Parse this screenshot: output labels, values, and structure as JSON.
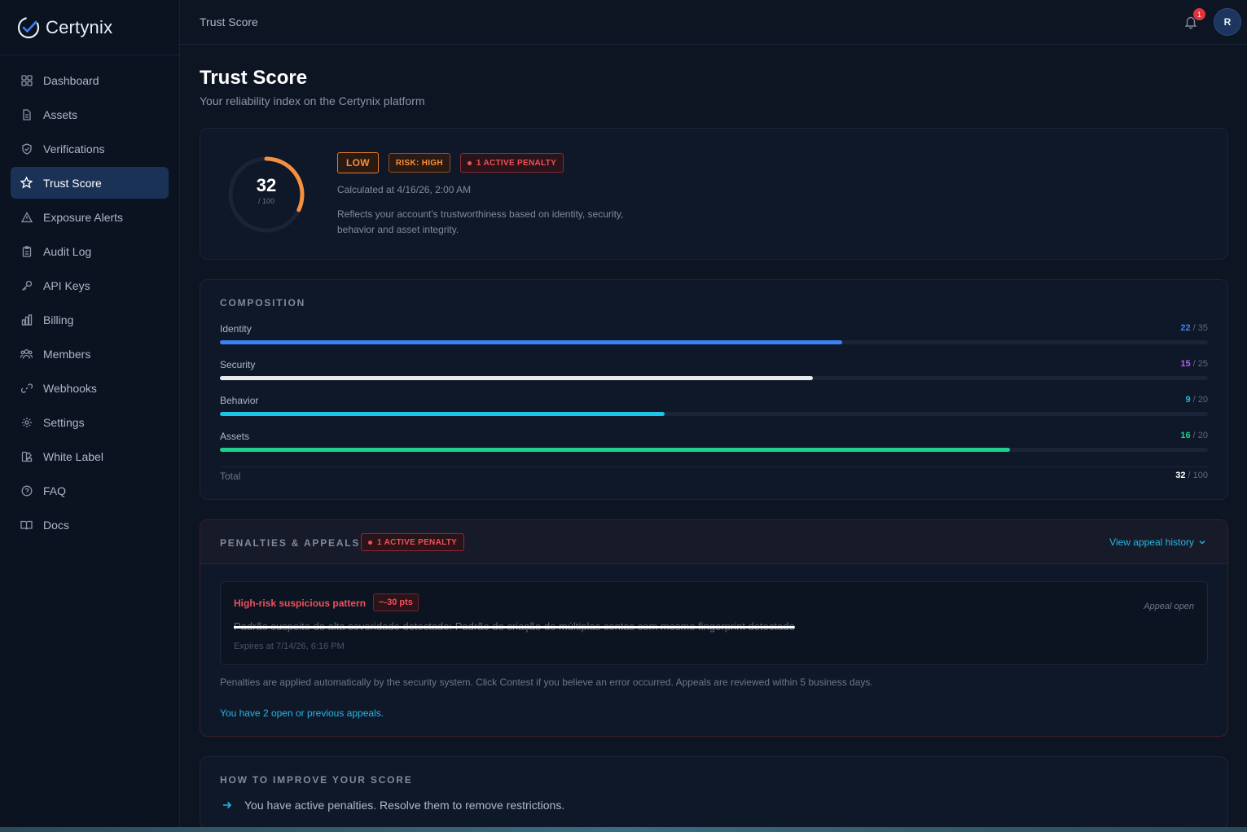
{
  "brand": {
    "name": "Certynix"
  },
  "sidebar": {
    "items": [
      {
        "label": "Dashboard",
        "icon": "dashboard-grid-icon"
      },
      {
        "label": "Assets",
        "icon": "document-icon"
      },
      {
        "label": "Verifications",
        "icon": "shield-check-icon"
      },
      {
        "label": "Trust Score",
        "icon": "star-icon",
        "active": true
      },
      {
        "label": "Exposure Alerts",
        "icon": "warning-triangle-icon"
      },
      {
        "label": "Audit Log",
        "icon": "clipboard-icon"
      },
      {
        "label": "API Keys",
        "icon": "key-icon"
      },
      {
        "label": "Billing",
        "icon": "bar-chart-icon"
      },
      {
        "label": "Members",
        "icon": "users-icon"
      },
      {
        "label": "Webhooks",
        "icon": "link-icon"
      },
      {
        "label": "Settings",
        "icon": "gear-icon"
      },
      {
        "label": "White Label",
        "icon": "palette-icon"
      },
      {
        "label": "FAQ",
        "icon": "help-circle-icon"
      },
      {
        "label": "Docs",
        "icon": "book-icon"
      }
    ]
  },
  "header": {
    "breadcrumb": "Trust Score",
    "notifications_count": "1",
    "avatar_initial": "R"
  },
  "page": {
    "title": "Trust Score",
    "subtitle": "Your reliability index on the Certynix platform"
  },
  "score": {
    "value": "32",
    "max_label": "/ 100",
    "fraction": 0.32,
    "level_badge": "LOW",
    "risk_badge": "RISK: HIGH",
    "penalty_badge": "1 ACTIVE PENALTY",
    "calculated": "Calculated at 4/16/26, 2:00 AM",
    "description": "Reflects your account's trustworthiness based on identity, security, behavior and asset integrity.",
    "gauge_color": "#f5913e"
  },
  "composition": {
    "label": "COMPOSITION",
    "rows": [
      {
        "label": "Identity",
        "value": "22",
        "max": "/ 35",
        "value_color": "#3b82f6",
        "bar_color": "#3b82f6",
        "fraction": 0.63
      },
      {
        "label": "Security",
        "value": "15",
        "max": "/ 25",
        "value_color": "#b35cf2",
        "bar_color": "#e8eaee",
        "fraction": 0.6
      },
      {
        "label": "Behavior",
        "value": "9",
        "max": "/ 20",
        "value_color": "#22b8e6",
        "bar_color": "#1cc4e6",
        "fraction": 0.45
      },
      {
        "label": "Assets",
        "value": "16",
        "max": "/ 20",
        "value_color": "#1fcf8e",
        "bar_color": "#1fcf8e",
        "fraction": 0.8
      }
    ],
    "total_label": "Total",
    "total_value": "32",
    "total_max": "/ 100"
  },
  "penalties": {
    "label": "PENALTIES & APPEALS",
    "badge": "1 ACTIVE PENALTY",
    "appeal_history_link": "View appeal history",
    "item": {
      "title": "High-risk suspicious pattern",
      "points": "−-30 pts",
      "status": "Appeal open",
      "description": "Padrão suspeito de alta severidade detectado: Padrão de criação de múltiplas contas com mesmo fingerprint detectado",
      "expires": "Expires at 7/14/26, 6:16 PM"
    },
    "note": "Penalties are applied automatically by the security system. Click Contest if you believe an error occurred. Appeals are reviewed within 5 business days.",
    "appeals_link": "You have 2 open or previous appeals."
  },
  "improve": {
    "label": "HOW TO IMPROVE YOUR SCORE",
    "items": [
      "You have active penalties. Resolve them to remove restrictions."
    ]
  }
}
